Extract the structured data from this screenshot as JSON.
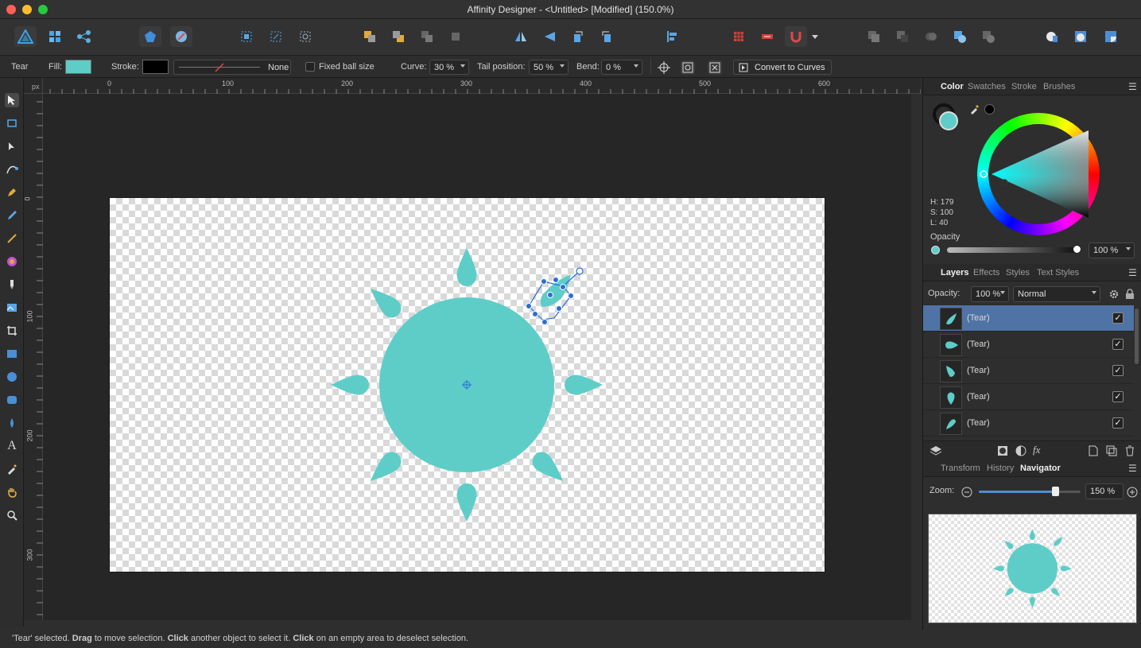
{
  "window": {
    "title": "Affinity Designer - <Untitled> [Modified] (150.0%)"
  },
  "context": {
    "shape_name": "Tear",
    "fill_label": "Fill:",
    "fill_color": "#5ecdc8",
    "stroke_label": "Stroke:",
    "stroke_color": "#000000",
    "stroke_style": "None",
    "fixed_ball_label": "Fixed ball size",
    "curve_label": "Curve:",
    "curve_value": "30 %",
    "tail_label": "Tail position:",
    "tail_value": "50 %",
    "bend_label": "Bend:",
    "bend_value": "0 %",
    "convert_label": "Convert to Curves"
  },
  "ruler": {
    "unit": "px",
    "top_ticks": [
      "0",
      "100",
      "200",
      "300",
      "400",
      "500",
      "600"
    ],
    "left_ticks": [
      "0",
      "100",
      "200",
      "300"
    ]
  },
  "color_panel": {
    "tabs": [
      "Color",
      "Swatches",
      "Stroke",
      "Brushes"
    ],
    "h": "H: 179",
    "s": "S: 100",
    "l": "L: 40",
    "opacity_label": "Opacity",
    "opacity_value": "100 %",
    "swatch": "#5ecdc8"
  },
  "layers_panel": {
    "tabs": [
      "Layers",
      "Effects",
      "Styles",
      "Text Styles"
    ],
    "opacity_label": "Opacity:",
    "opacity_value": "100 %",
    "blend_mode": "Normal",
    "layers": [
      {
        "name": "(Tear)",
        "selected": true,
        "visible": true
      },
      {
        "name": "(Tear)",
        "selected": false,
        "visible": true
      },
      {
        "name": "(Tear)",
        "selected": false,
        "visible": true
      },
      {
        "name": "(Tear)",
        "selected": false,
        "visible": true
      },
      {
        "name": "(Tear)",
        "selected": false,
        "visible": true
      }
    ]
  },
  "navigator_panel": {
    "tabs": [
      "Transform",
      "History",
      "Navigator"
    ],
    "zoom_label": "Zoom:",
    "zoom_value": "150 %",
    "zoom_fraction": 0.75
  },
  "status": {
    "text_parts": [
      {
        "t": "'Tear' selected. ",
        "b": false
      },
      {
        "t": "Drag",
        "b": true
      },
      {
        "t": " to move selection. ",
        "b": false
      },
      {
        "t": "Click",
        "b": true
      },
      {
        "t": " another object to select it. ",
        "b": false
      },
      {
        "t": "Click",
        "b": true
      },
      {
        "t": " on an empty area to deselect selection.",
        "b": false
      }
    ]
  },
  "art": {
    "shape_color": "#5ecdc8",
    "selection_color": "#2a6fd6"
  }
}
